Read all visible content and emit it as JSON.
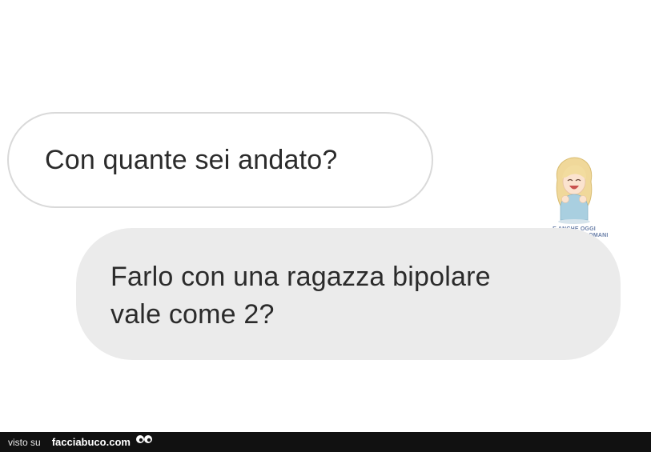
{
  "conversation": {
    "received_message": "Con quante sei andato?",
    "sent_message_lines": [
      "Farlo con una ragazza bipolare",
      "vale come 2?"
    ]
  },
  "watermark": {
    "line1": "E ANCHE OGGI",
    "line2": "SI RIMORCHIO DOMANI"
  },
  "footer": {
    "visto_label": "visto su",
    "site_name": "facciabuco.com",
    "eyes_icon": "eyes-icon"
  },
  "colors": {
    "sent_bubble": "#ebebeb",
    "received_border": "#d9d9d9",
    "footer_bg": "#111111",
    "text": "#2b2b2b"
  }
}
